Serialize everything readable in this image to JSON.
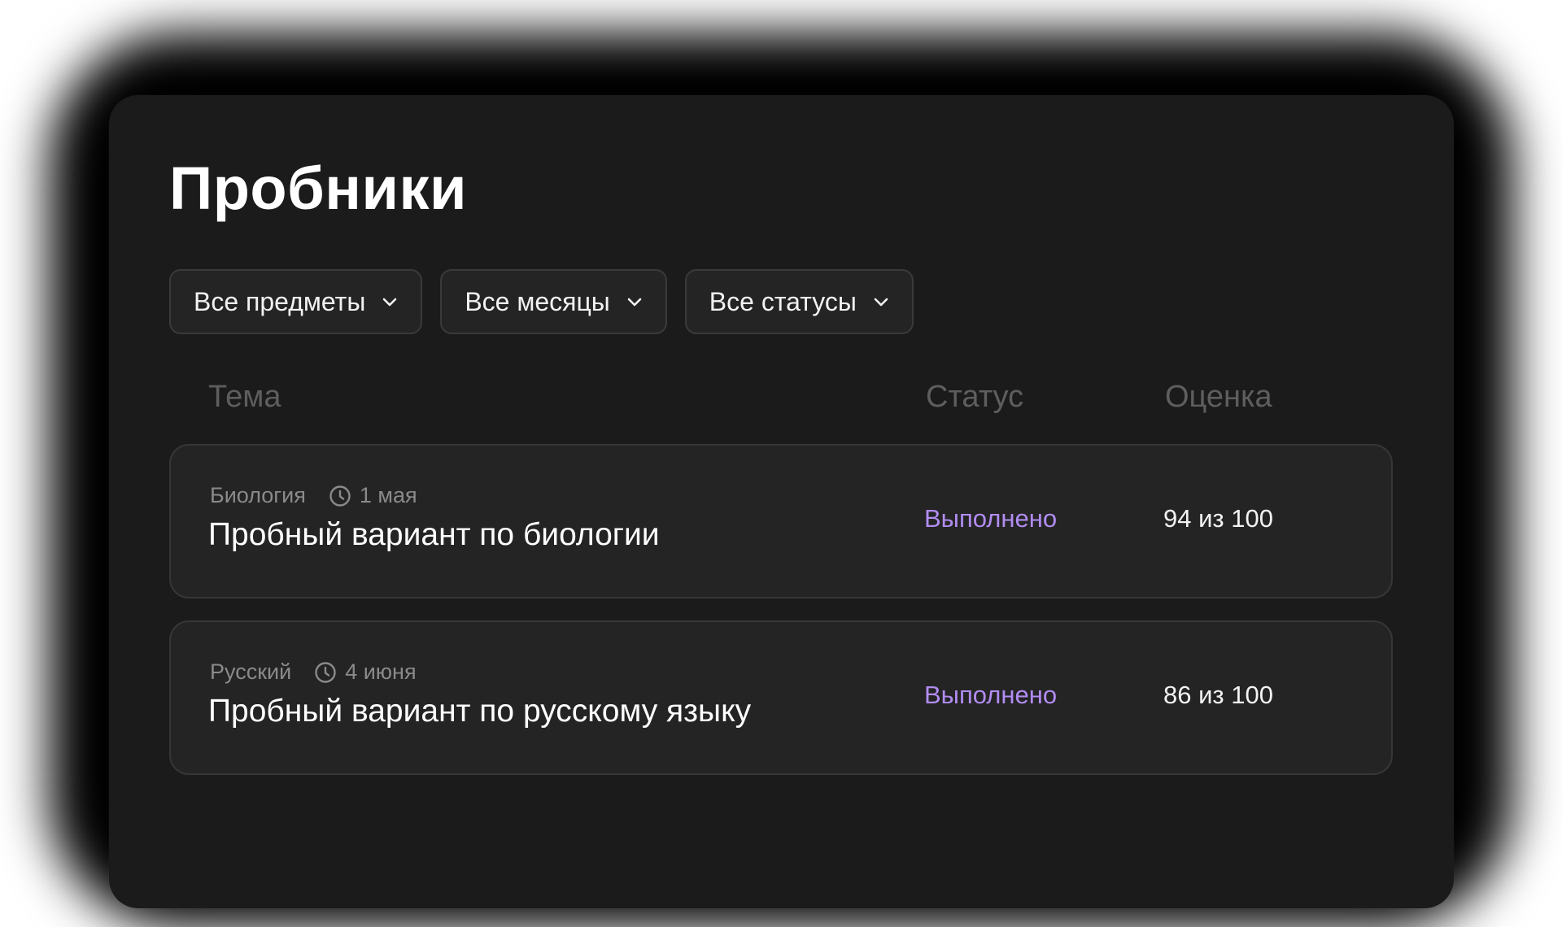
{
  "page": {
    "title": "Пробники"
  },
  "filters": [
    {
      "label": "Все предметы",
      "icon": "chevron-down-icon"
    },
    {
      "label": "Все месяцы",
      "icon": "chevron-down-icon"
    },
    {
      "label": "Все статусы",
      "icon": "chevron-down-icon"
    }
  ],
  "table": {
    "headers": {
      "topic": "Тема",
      "status": "Статус",
      "score": "Оценка"
    },
    "rows": [
      {
        "subject": "Биология",
        "date": "1 мая",
        "title": "Пробный вариант по биологии",
        "status": "Выполнено",
        "score": "94 из 100"
      },
      {
        "subject": "Русский",
        "date": "4 июня",
        "title": "Пробный вариант по русскому языку",
        "status": "Выполнено",
        "score": "86 из 100"
      }
    ]
  },
  "colors": {
    "background": "#1b1b1b",
    "card": "#242424",
    "status_done": "#b18cf2"
  }
}
